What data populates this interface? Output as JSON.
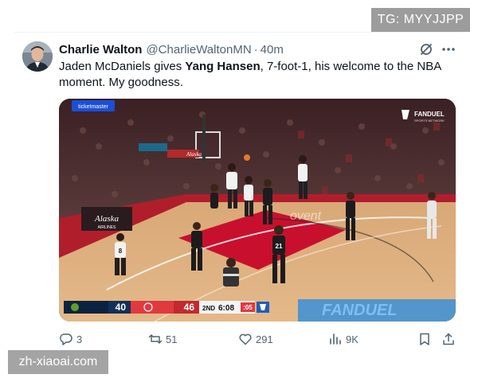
{
  "watermarks": {
    "top": "TG: MYYJJPP",
    "bottom": "zh-xiaoai.com"
  },
  "tweet": {
    "author_name": "Charlie Walton",
    "handle": "@CharlieWaltonMN",
    "separator": "·",
    "time": "40m",
    "text_part1": "Jaden McDaniels gives ",
    "text_bold": "Yang Hansen",
    "text_part2": ", 7-foot-1, his welcome to the NBA moment. My goodness."
  },
  "media": {
    "scorebug": {
      "away_score": "40",
      "home_score": "46",
      "quarter": "2ND",
      "clock": "6:08",
      "shot_clock": ":05"
    },
    "broadcaster": "FANDUEL",
    "broadcaster_sub": "SPORTS NETWORK",
    "ad_ticketmaster": "ticketmaster",
    "ad_alaska": "Alaska",
    "ad_alaska_sub": "AIRLINES",
    "ad_alaska_small": "Alaska",
    "floor_text": "ovent",
    "banner_text": "FANDUEL",
    "jersey_numbers": [
      "21",
      "8"
    ]
  },
  "actions": {
    "replies": "3",
    "reposts": "51",
    "likes": "291",
    "views": "9K"
  },
  "icons": {
    "reply": "reply-icon",
    "repost": "repost-icon",
    "like": "heart-icon",
    "views": "views-icon",
    "bookmark": "bookmark-icon",
    "share": "share-icon",
    "grok": "grok-icon",
    "more": "more-icon"
  },
  "colors": {
    "accent_gray": "#536471",
    "text": "#0f1419",
    "court_red": "#c8102e",
    "timberwolves_navy": "#0c2340",
    "blazers_red": "#e03a3e"
  }
}
